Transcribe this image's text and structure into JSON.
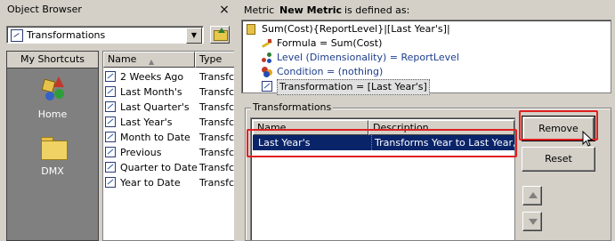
{
  "object_browser": {
    "title": "Object Browser",
    "close_glyph": "×",
    "folder_select": {
      "value": "Transformations"
    },
    "shortcuts": {
      "header": "My Shortcuts",
      "items": [
        {
          "label": "Home"
        },
        {
          "label": "DMX"
        }
      ]
    },
    "columns": {
      "name": "Name",
      "type": "Type",
      "sort_glyph": "▲"
    },
    "items": [
      {
        "name": "2 Weeks Ago",
        "type": "Transfc"
      },
      {
        "name": "Last Month's",
        "type": "Transfc"
      },
      {
        "name": "Last Quarter's",
        "type": "Transfc"
      },
      {
        "name": "Last Year's",
        "type": "Transfc"
      },
      {
        "name": "Month to Date",
        "type": "Transfc"
      },
      {
        "name": "Previous",
        "type": "Transfc"
      },
      {
        "name": "Quarter to Date",
        "type": "Transfc"
      },
      {
        "name": "Year to Date",
        "type": "Transfc"
      }
    ]
  },
  "metric_definition": {
    "prefix": "Metric",
    "metric_name": "New Metric",
    "suffix": "is defined as:",
    "tree": {
      "root": "Sum(Cost){ReportLevel}|[Last Year's]|",
      "formula": "Formula = Sum(Cost)",
      "level": "Level (Dimensionality) = ReportLevel",
      "condition": "Condition = (nothing)",
      "transformation": "Transformation = [Last Year's]"
    }
  },
  "transformations_panel": {
    "group_label": "Transformations",
    "columns": {
      "name": "Name",
      "description": "Description"
    },
    "rows": [
      {
        "name": "Last Year's",
        "description": "Transforms Year to Last Year, Qu"
      }
    ],
    "buttons": {
      "remove": "Remove",
      "reset": "Reset"
    }
  },
  "highlight_color": "#e02020",
  "selection_color": "#0a246a"
}
